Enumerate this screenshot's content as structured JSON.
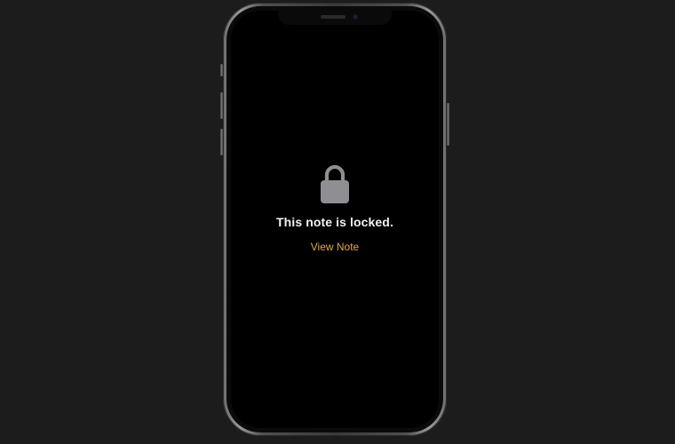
{
  "screen": {
    "lock_icon": "lock-icon",
    "title": "This note is locked.",
    "action_label": "View Note"
  },
  "colors": {
    "background": "#1c1c1c",
    "screen": "#000000",
    "title_text": "#f2f2f2",
    "accent": "#e2a93b",
    "lock_icon": "#8e8e93"
  }
}
